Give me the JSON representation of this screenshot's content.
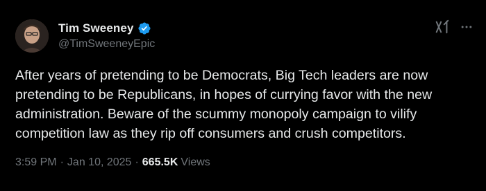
{
  "author": {
    "name": "Tim Sweeney",
    "handle": "@TimSweeneyEpic",
    "verified": true,
    "verified_color": "#1d9bf0"
  },
  "tweet": {
    "text_lines": [
      "After years of pretending to be Democrats, Big Tech leaders are now",
      "pretending to be Republicans, in hopes of currying favor with the new",
      "administration. Beware of the scummy monopoly campaign to vilify",
      "competition law as they rip off consumers and crush competitors."
    ],
    "time": "3:59 PM",
    "date": "Jan 10, 2025",
    "separator": "·",
    "views_count": "665.5K",
    "views_label": "Views"
  },
  "icons": {
    "grok": "grok-icon",
    "more": "more-options-icon",
    "verified": "verified-badge-icon"
  },
  "colors": {
    "background": "#000000",
    "text_primary": "#e7e9ea",
    "text_secondary": "#71767b"
  }
}
